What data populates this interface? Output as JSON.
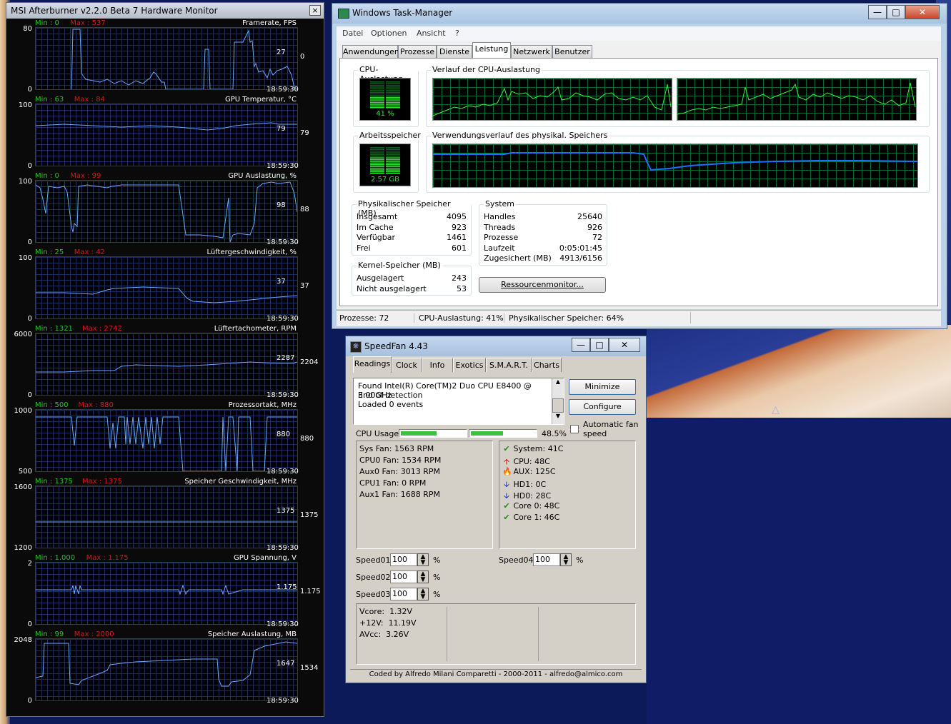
{
  "afterburner": {
    "title": "MSI Afterburner v2.2.0 Beta 7 Hardware Monitor",
    "close": "×",
    "graphs": [
      {
        "name": "Framerate, FPS",
        "min": "Min : 0",
        "max": "Max : 537",
        "axis_top": "80",
        "axis_bottom": "0",
        "current": "0",
        "inner": "27",
        "time": "18:59:30"
      },
      {
        "name": "GPU Temperatur, °C",
        "min": "Min : 63",
        "max": "Max : 84",
        "axis_top": "100",
        "axis_bottom": "0",
        "current": "79",
        "inner": "79",
        "time": "18:59:30"
      },
      {
        "name": "GPU Auslastung, %",
        "min": "Min : 0",
        "max": "Max : 99",
        "axis_top": "100",
        "axis_bottom": "0",
        "current": "88",
        "inner": "98",
        "time": "18:59:30"
      },
      {
        "name": "Lüftergeschwindigkeit, %",
        "min": "Min : 25",
        "max": "Max : 42",
        "axis_top": "100",
        "axis_bottom": "0",
        "current": "37",
        "inner": "37",
        "time": "18:59:30"
      },
      {
        "name": "Lüftertachometer, RPM",
        "min": "Min : 1321",
        "max": "Max : 2742",
        "axis_top": "6000",
        "axis_bottom": "0",
        "current": "2204",
        "inner": "2287",
        "time": "18:59:30"
      },
      {
        "name": "Prozessortakt, MHz",
        "min": "Min : 500",
        "max": "Max : 880",
        "axis_top": "1000",
        "axis_bottom": "500",
        "current": "880",
        "inner": "880",
        "time": "18:59:30"
      },
      {
        "name": "Speicher Geschwindigkeit, MHz",
        "min": "Min : 1375",
        "max": "Max : 1375",
        "axis_top": "1600",
        "axis_bottom": "1200",
        "current": "1375",
        "inner": "1375",
        "time": "18:59:30"
      },
      {
        "name": "GPU Spannung, V",
        "min": "Min : 1.000",
        "max": "Max : 1.175",
        "axis_top": "2",
        "axis_bottom": "0",
        "current": "1.175",
        "inner": "1.175",
        "time": "18:59:30"
      },
      {
        "name": "Speicher Auslastung, MB",
        "min": "Min : 99",
        "max": "Max : 2000",
        "axis_top": "2048",
        "axis_bottom": "0",
        "current": "1534",
        "inner": "1647",
        "time": "18:59:30"
      }
    ]
  },
  "taskmanager": {
    "title": "Windows Task-Manager",
    "menu": [
      "Datei",
      "Optionen",
      "Ansicht",
      "?"
    ],
    "tabs": [
      "Anwendungen",
      "Prozesse",
      "Dienste",
      "Leistung",
      "Netzwerk",
      "Benutzer"
    ],
    "active_tab": "Leistung",
    "cpu_label": "CPU-Auslastung",
    "cpu_value": "41 %",
    "cpu_history_label": "Verlauf der CPU-Auslastung",
    "mem_label": "Arbeitsspeicher",
    "mem_value": "2.57 GB",
    "mem_history_label": "Verwendungsverlauf des physikal. Speichers",
    "phys": {
      "title": "Physikalischer Speicher (MB)",
      "rows": [
        [
          "Insgesamt",
          "4095"
        ],
        [
          "Im Cache",
          "923"
        ],
        [
          "Verfügbar",
          "1461"
        ],
        [
          "Frei",
          "601"
        ]
      ]
    },
    "kernel": {
      "title": "Kernel-Speicher (MB)",
      "rows": [
        [
          "Ausgelagert",
          "243"
        ],
        [
          "Nicht ausgelagert",
          "53"
        ]
      ]
    },
    "system": {
      "title": "System",
      "rows": [
        [
          "Handles",
          "25640"
        ],
        [
          "Threads",
          "926"
        ],
        [
          "Prozesse",
          "72"
        ],
        [
          "Laufzeit",
          "0:05:01:45"
        ],
        [
          "Zugesichert (MB)",
          "4913/6156"
        ]
      ]
    },
    "resmon_button": "Ressourcenmonitor...",
    "status": {
      "processes": "Prozesse: 72",
      "cpu": "CPU-Auslastung: 41%",
      "mem": "Physikalischer Speicher: 64%"
    },
    "cpu_percent": 41,
    "mem_percent": 64
  },
  "speedfan": {
    "title": "SpeedFan 4.43",
    "tabs": [
      "Readings",
      "Clock",
      "Info",
      "Exotics",
      "S.M.A.R.T.",
      "Charts"
    ],
    "log": [
      "Found Intel(R) Core(TM)2 Duo CPU E8400 @ 3.00GHz",
      "End of detection",
      "Loaded 0 events"
    ],
    "minimize": "Minimize",
    "configure": "Configure",
    "auto_fan": "Automatic fan speed",
    "cpu_usage_label": "CPU Usage",
    "cpu_usage_value": "48.5%",
    "cpu_usage_levels": [
      0.55,
      0.5
    ],
    "fans": [
      [
        "Sys Fan:",
        "1563 RPM"
      ],
      [
        "CPU0 Fan:",
        "1534 RPM"
      ],
      [
        "Aux0 Fan:",
        "3013 RPM"
      ],
      [
        "CPU1 Fan:",
        "0 RPM"
      ],
      [
        "Aux1 Fan:",
        "1688 RPM"
      ]
    ],
    "temps": [
      {
        "icon": "check",
        "label": "System:",
        "value": "41C"
      },
      {
        "icon": "up",
        "label": "CPU:",
        "value": "48C"
      },
      {
        "icon": "fire",
        "label": "AUX:",
        "value": "125C"
      },
      {
        "icon": "down",
        "label": "HD1:",
        "value": "0C"
      },
      {
        "icon": "down",
        "label": "HD0:",
        "value": "28C"
      },
      {
        "icon": "check",
        "label": "Core 0:",
        "value": "48C"
      },
      {
        "icon": "check",
        "label": "Core 1:",
        "value": "46C"
      }
    ],
    "speeds": [
      [
        "Speed01:",
        "100",
        "%"
      ],
      [
        "Speed02:",
        "100",
        "%"
      ],
      [
        "Speed03:",
        "100",
        "%"
      ],
      [
        "Speed04:",
        "100",
        "%"
      ]
    ],
    "volts": [
      [
        "Vcore:",
        "1.32V"
      ],
      [
        "+12V:",
        "11.19V"
      ],
      [
        "AVcc:",
        "3.26V"
      ]
    ],
    "footer": "Coded by Alfredo Milani Comparetti - 2000-2011 - alfredo@almico.com"
  }
}
